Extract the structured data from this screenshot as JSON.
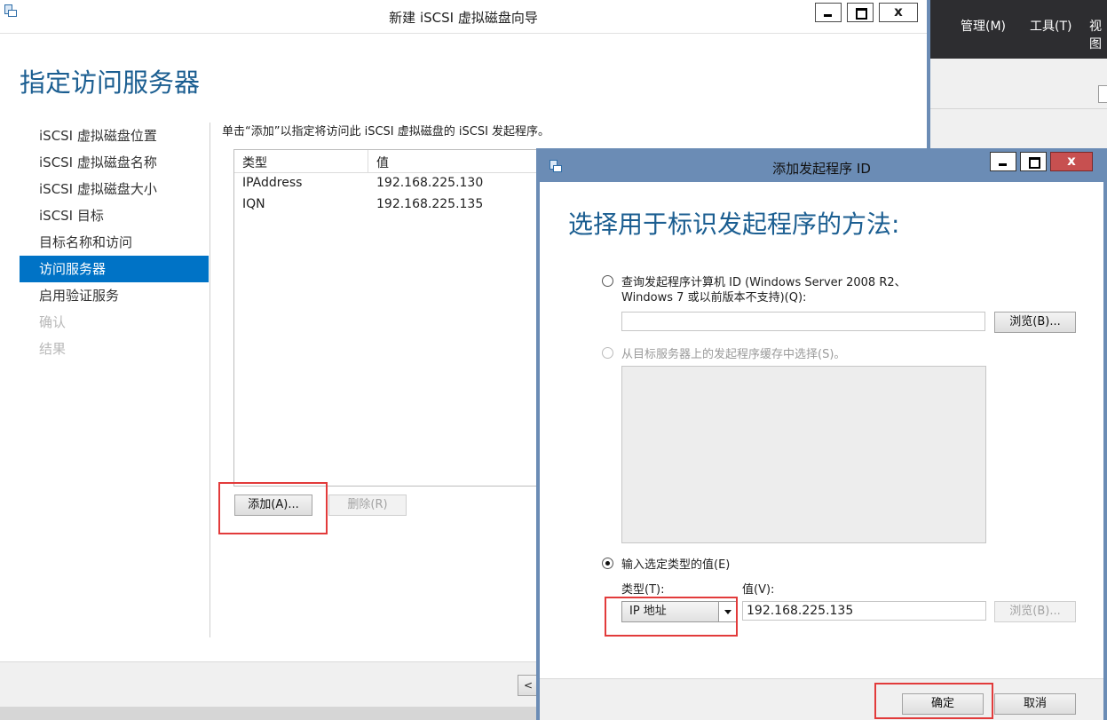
{
  "background_app": {
    "menu": [
      "管理(M)",
      "工具(T)",
      "视图"
    ]
  },
  "wizard": {
    "title": "新建 iSCSI 虚拟磁盘向导",
    "heading": "指定访问服务器",
    "nav": [
      {
        "label": "iSCSI 虚拟磁盘位置",
        "state": "normal"
      },
      {
        "label": "iSCSI 虚拟磁盘名称",
        "state": "normal"
      },
      {
        "label": "iSCSI 虚拟磁盘大小",
        "state": "normal"
      },
      {
        "label": "iSCSI 目标",
        "state": "normal"
      },
      {
        "label": "目标名称和访问",
        "state": "normal"
      },
      {
        "label": "访问服务器",
        "state": "active"
      },
      {
        "label": "启用验证服务",
        "state": "normal"
      },
      {
        "label": "确认",
        "state": "disabled"
      },
      {
        "label": "结果",
        "state": "disabled"
      }
    ],
    "instruction": "单击“添加”以指定将访问此 iSCSI 虚拟磁盘的 iSCSI 发起程序。",
    "table": {
      "columns": [
        "类型",
        "值"
      ],
      "rows": [
        [
          "IPAddress",
          "192.168.225.130"
        ],
        [
          "IQN",
          "192.168.225.135"
        ]
      ]
    },
    "add_button": "添加(A)...",
    "remove_button": "删除(R)",
    "back_button": "<"
  },
  "dialog": {
    "title": "添加发起程序 ID",
    "heading": "选择用于标识发起程序的方法:",
    "option1_line1": "查询发起程序计算机 ID (Windows Server 2008 R2、",
    "option1_line2": "Windows 7 或以前版本不支持)(Q):",
    "option1_value": "",
    "browse1": "浏览(B)...",
    "option2_label": "从目标服务器上的发起程序缓存中选择(S)。",
    "option3_label": "输入选定类型的值(E)",
    "type_label": "类型(T):",
    "value_label": "值(V):",
    "type_selected": "IP 地址",
    "value": "192.168.225.135",
    "browse2": "浏览(B)...",
    "ok": "确定",
    "cancel": "取消",
    "close_glyph": "x"
  },
  "colors": {
    "accent_blue": "#0073c6",
    "heading_blue": "#1b5e91",
    "highlight_red": "#e23b3b"
  }
}
